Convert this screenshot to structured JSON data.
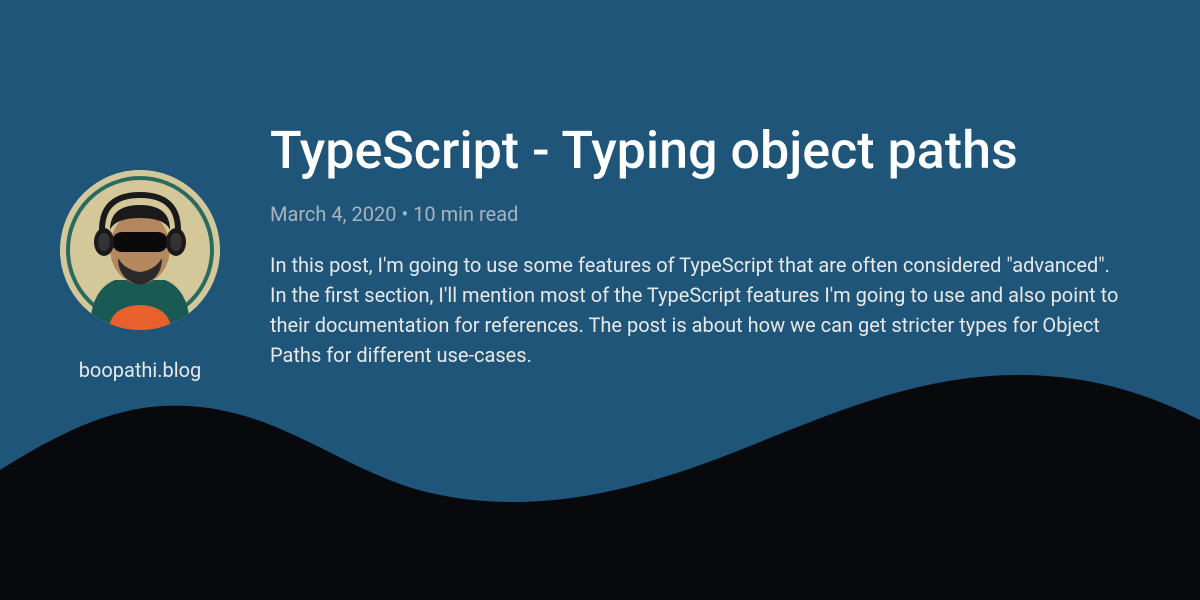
{
  "site": {
    "name": "boopathi.blog"
  },
  "post": {
    "title": "TypeScript - Typing object paths",
    "date": "March 4, 2020",
    "read_time": "10 min read",
    "meta_separator": " • ",
    "excerpt": "In this post, I'm going to use some features of TypeScript that are often considered \"advanced\". In the first section, I'll mention most of the TypeScript features I'm going to use and also point to their documentation for references. The post is about how we can get stricter types for Object Paths for different use-cases."
  },
  "colors": {
    "background": "#1e5578",
    "wave": "#08090d",
    "text_primary": "#ffffff",
    "text_secondary": "#a8b4bd",
    "text_body": "#e8e8e8"
  }
}
